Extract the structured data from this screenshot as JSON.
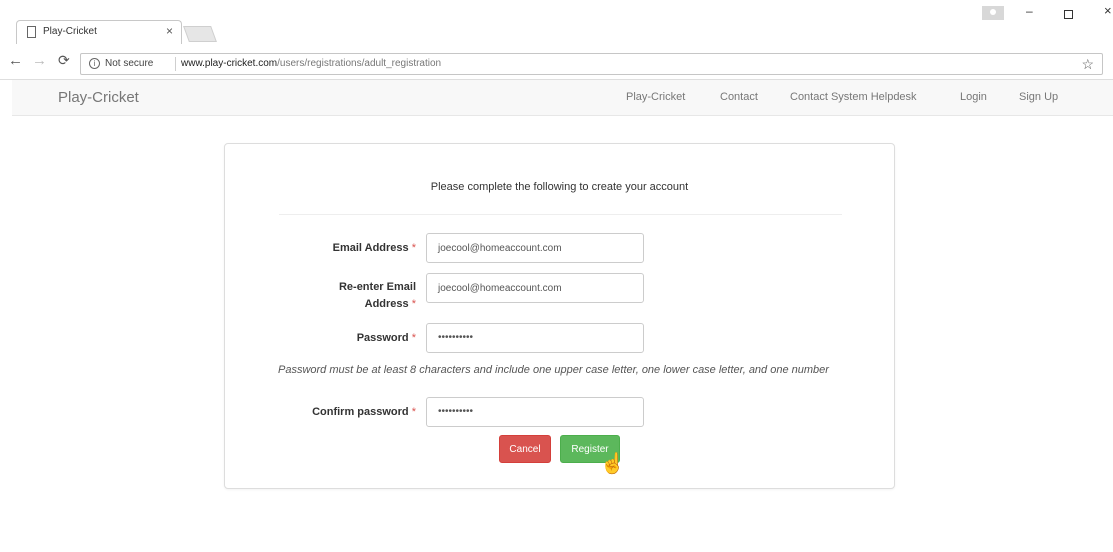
{
  "browser": {
    "tab_title": "Play-Cricket",
    "tab_close": "×",
    "security_label": "Not secure",
    "url_host": "www.play-cricket.com",
    "url_path": "/users/registrations/adult_registration",
    "window_min": "–",
    "window_close": "×"
  },
  "site_nav": {
    "brand": "Play-Cricket",
    "links": [
      "Play-Cricket",
      "Contact",
      "Contact System Helpdesk",
      "Login",
      "Sign Up"
    ]
  },
  "form": {
    "intro": "Please complete the following to create your account",
    "required_marker": "*",
    "email_label": "Email Address",
    "email_value": "joecool@homeaccount.com",
    "reemail_label_line1": "Re-enter Email",
    "reemail_label_line2": "Address",
    "reemail_value": "joecool@homeaccount.com",
    "password_label": "Password",
    "password_value": "••••••••••",
    "password_hint": "Password must be at least 8 characters and include one upper case letter, one lower case letter, and one number",
    "confirm_label": "Confirm password",
    "confirm_value": "••••••••••",
    "cancel_label": "Cancel",
    "register_label": "Register"
  },
  "colors": {
    "cancel": "#d9534f",
    "register": "#5cb85c",
    "required": "#d9534f"
  }
}
